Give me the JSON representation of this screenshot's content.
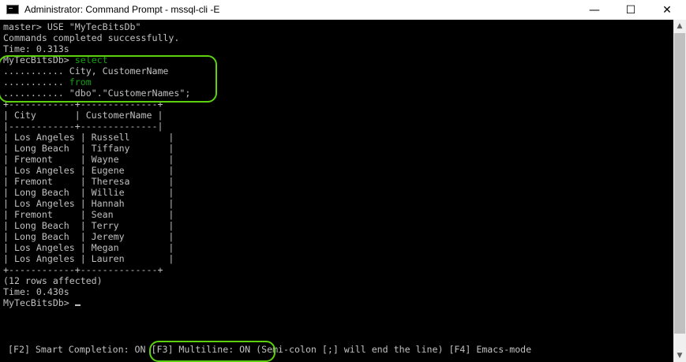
{
  "window": {
    "title": "Administrator: Command Prompt - mssql-cli  -E",
    "icon": "cmd-console-icon",
    "controls": {
      "minimize": "—",
      "maximize": "☐",
      "close": "✕"
    }
  },
  "colors": {
    "console_bg": "#000000",
    "console_text": "#c0c0c0",
    "keyword": "#16a016",
    "highlight_ring": "#5cd10f"
  },
  "session": {
    "use_command": "master> USE \"MyTecBitsDb\"",
    "use_result": "Commands completed successfully.",
    "use_time": "Time: 0.313s",
    "query": {
      "prompt": "MyTecBitsDb> ",
      "line1_kw": "select",
      "line2": "........... City, CustomerName",
      "line3_prefix": "........... ",
      "line3_kw": "from",
      "line4": "........... \"dbo\".\"CustomerNames\";"
    },
    "table_border": "+------------+--------------+",
    "table_header": "| City       | CustomerName |",
    "table_separator": "|------------+--------------|",
    "rows": [
      "| Los Angeles | Russell       |",
      "| Long Beach  | Tiffany       |",
      "| Fremont     | Wayne         |",
      "| Los Angeles | Eugene        |",
      "| Fremont     | Theresa       |",
      "| Long Beach  | Willie        |",
      "| Los Angeles | Hannah        |",
      "| Fremont     | Sean          |",
      "| Long Beach  | Terry         |",
      "| Long Beach  | Jeremy        |",
      "| Los Angeles | Megan         |",
      "| Los Angeles | Lauren        |"
    ],
    "rows_affected": "(12 rows affected)",
    "query_time": "Time: 0.430s",
    "final_prompt": "MyTecBitsDb>"
  },
  "status_bar": {
    "smart_completion": "[F2] Smart Completion: ON",
    "multiline": "[F3] Multiline: ON",
    "hint": "(Semi-colon [;] will end the line)",
    "emacs": "[F4] Emacs-mode"
  }
}
